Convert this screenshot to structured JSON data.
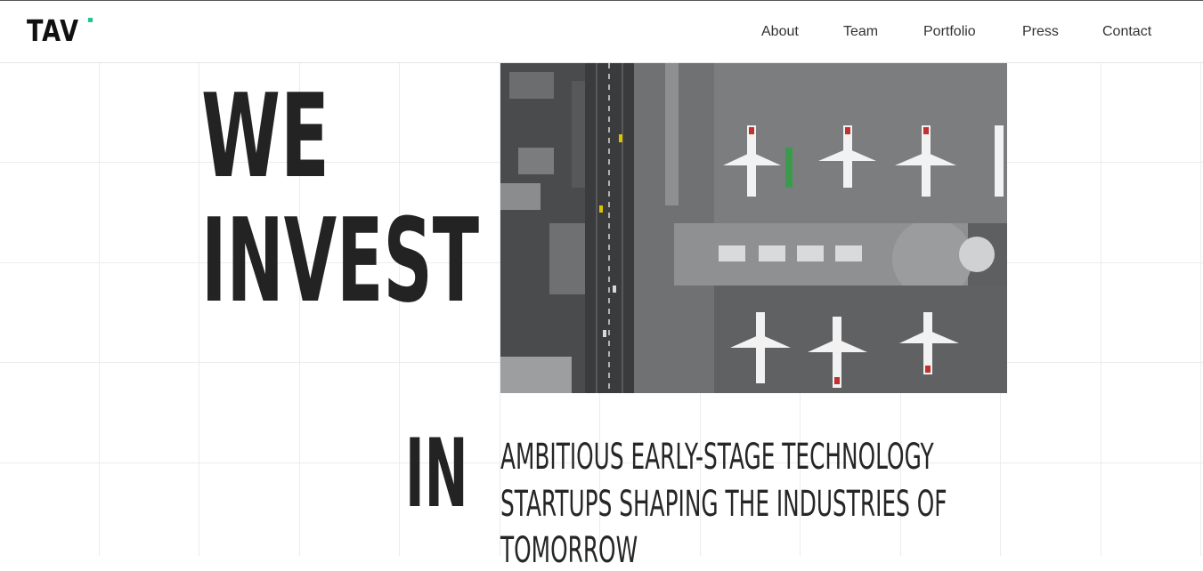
{
  "brand": {
    "logo_text": "TAV",
    "accent_color": "#1fc78a"
  },
  "nav": {
    "items": [
      {
        "label": "About"
      },
      {
        "label": "Team"
      },
      {
        "label": "Portfolio"
      },
      {
        "label": "Press"
      },
      {
        "label": "Contact"
      }
    ]
  },
  "hero": {
    "headline_line1": "WE",
    "headline_line2": "INVEST",
    "in_word": "IN",
    "tagline_lines": [
      "AMBITIOUS EARLY-STAGE TECHNOLOGY",
      "STARTUPS SHAPING THE INDUSTRIES OF",
      "TOMORROW"
    ],
    "image_subject": "aerial-airport-photo"
  }
}
